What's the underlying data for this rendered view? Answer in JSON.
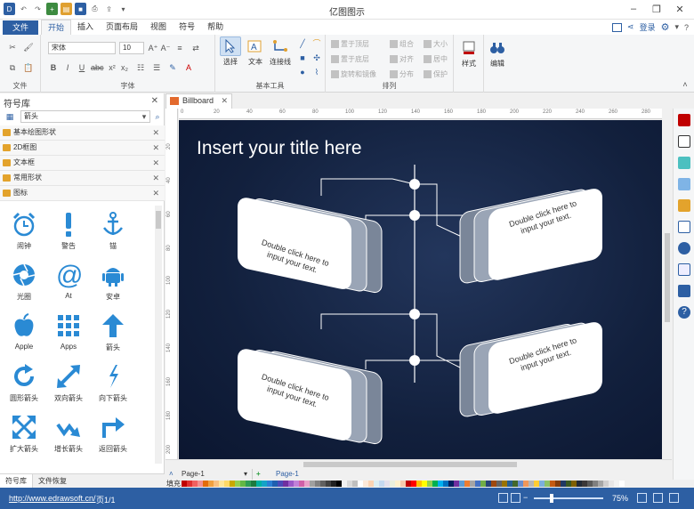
{
  "app": {
    "title": "亿图图示",
    "file_tab": "文件",
    "tabs": [
      "开始",
      "插入",
      "页面布局",
      "视图",
      "符号",
      "帮助"
    ],
    "login": "登录"
  },
  "ribbon": {
    "groups": {
      "file": "文件",
      "font": "字体",
      "tools": "基本工具",
      "arrange": "排列"
    },
    "font_name": "宋体",
    "font_size": "10",
    "tool_select": "选择",
    "tool_text": "文本",
    "tool_connector": "连接线",
    "arrange_items": [
      "置于顶层",
      "组合",
      "大小",
      "置于底层",
      "对齐",
      "居中",
      "旋转和镜像",
      "分布",
      "保护"
    ],
    "style_label": "样式",
    "edit_label": "编辑"
  },
  "library": {
    "title": "符号库",
    "search_value": "箭头",
    "items": [
      "基本绘图形状",
      "2D框图",
      "文本框",
      "常用形状",
      "图标"
    ],
    "shapes": [
      {
        "label": "闹钟",
        "icon": "alarm-clock-icon"
      },
      {
        "label": "警告",
        "icon": "warning-icon"
      },
      {
        "label": "锚",
        "icon": "anchor-icon"
      },
      {
        "label": "光圈",
        "icon": "aperture-icon"
      },
      {
        "label": "At",
        "icon": "at-icon"
      },
      {
        "label": "安卓",
        "icon": "android-icon"
      },
      {
        "label": "Apple",
        "icon": "apple-icon"
      },
      {
        "label": "Apps",
        "icon": "apps-grid-icon"
      },
      {
        "label": "箭头",
        "icon": "arrow-up-icon"
      },
      {
        "label": "圆形箭头",
        "icon": "circular-arrow-icon"
      },
      {
        "label": "双向箭头",
        "icon": "double-arrow-icon"
      },
      {
        "label": "向下箭头",
        "icon": "arrow-down-icon"
      },
      {
        "label": "扩大箭头",
        "icon": "expand-arrows-icon"
      },
      {
        "label": "增长箭头",
        "icon": "growth-arrow-icon"
      },
      {
        "label": "返回箭头",
        "icon": "return-arrow-icon"
      }
    ],
    "bottom_tabs": [
      "符号库",
      "文件恢复"
    ]
  },
  "document": {
    "tab_title": "Billboard",
    "ruler_h": [
      "0",
      "20",
      "40",
      "60",
      "80",
      "100",
      "120",
      "140",
      "160",
      "180",
      "200",
      "220",
      "240",
      "260",
      "280"
    ],
    "ruler_v": [
      "20",
      "40",
      "60",
      "80",
      "100",
      "120",
      "140",
      "160",
      "180",
      "200"
    ],
    "slide_title": "Insert your title here",
    "card_text_line1": "Double click here to",
    "card_text_line2": "input your text."
  },
  "pages": {
    "selector": "Page-1",
    "active": "Page-1"
  },
  "palette": {
    "label": "填充",
    "colors": [
      "#c00000",
      "#e03030",
      "#f06060",
      "#f49090",
      "#e46c0a",
      "#f0a040",
      "#f8c080",
      "#ffe699",
      "#ffd966",
      "#c9a800",
      "#92d050",
      "#63b846",
      "#2e9e55",
      "#1d7a3e",
      "#00b0a0",
      "#14a3c7",
      "#2a7fd4",
      "#1f5fb0",
      "#4a4ab8",
      "#7030a0",
      "#9a58c8",
      "#c080d8",
      "#d060a8",
      "#e8a0c8",
      "#a0a0a0",
      "#808080",
      "#606060",
      "#404040",
      "#202020",
      "#000000",
      "#f2f2f2",
      "#d9d9d9",
      "#bfbfbf",
      "#ffffff",
      "#fde9d9",
      "#fbd4b4",
      "#dbeef3",
      "#c6d9f0",
      "#e5e0ec",
      "#ebf1dd",
      "#fff2cc",
      "#f8cbad",
      "#c00000",
      "#ff0000",
      "#ffc000",
      "#ffff00",
      "#92d050",
      "#00b050",
      "#00b0f0",
      "#0070c0",
      "#002060",
      "#7030a0",
      "#5b9bd5",
      "#ed7d31",
      "#a5a5a5",
      "#4472c4",
      "#70ad47",
      "#264478",
      "#9e480e",
      "#636363",
      "#997300",
      "#255e91",
      "#43682b",
      "#698ed0",
      "#f1975a",
      "#b7b7b7",
      "#ffcd33",
      "#7cafdd",
      "#8cc168",
      "#c55a11",
      "#833c0b",
      "#1f3864",
      "#385723",
      "#7f6000",
      "#222a35",
      "#3b3838",
      "#595959",
      "#7f7f7f",
      "#a6a6a6",
      "#d0cece",
      "#e7e6e6",
      "#f2f2f2",
      "#ffffff"
    ]
  },
  "status": {
    "url": "http://www.edrawsoft.cn/",
    "page": "页1/1",
    "zoom": "75%"
  }
}
